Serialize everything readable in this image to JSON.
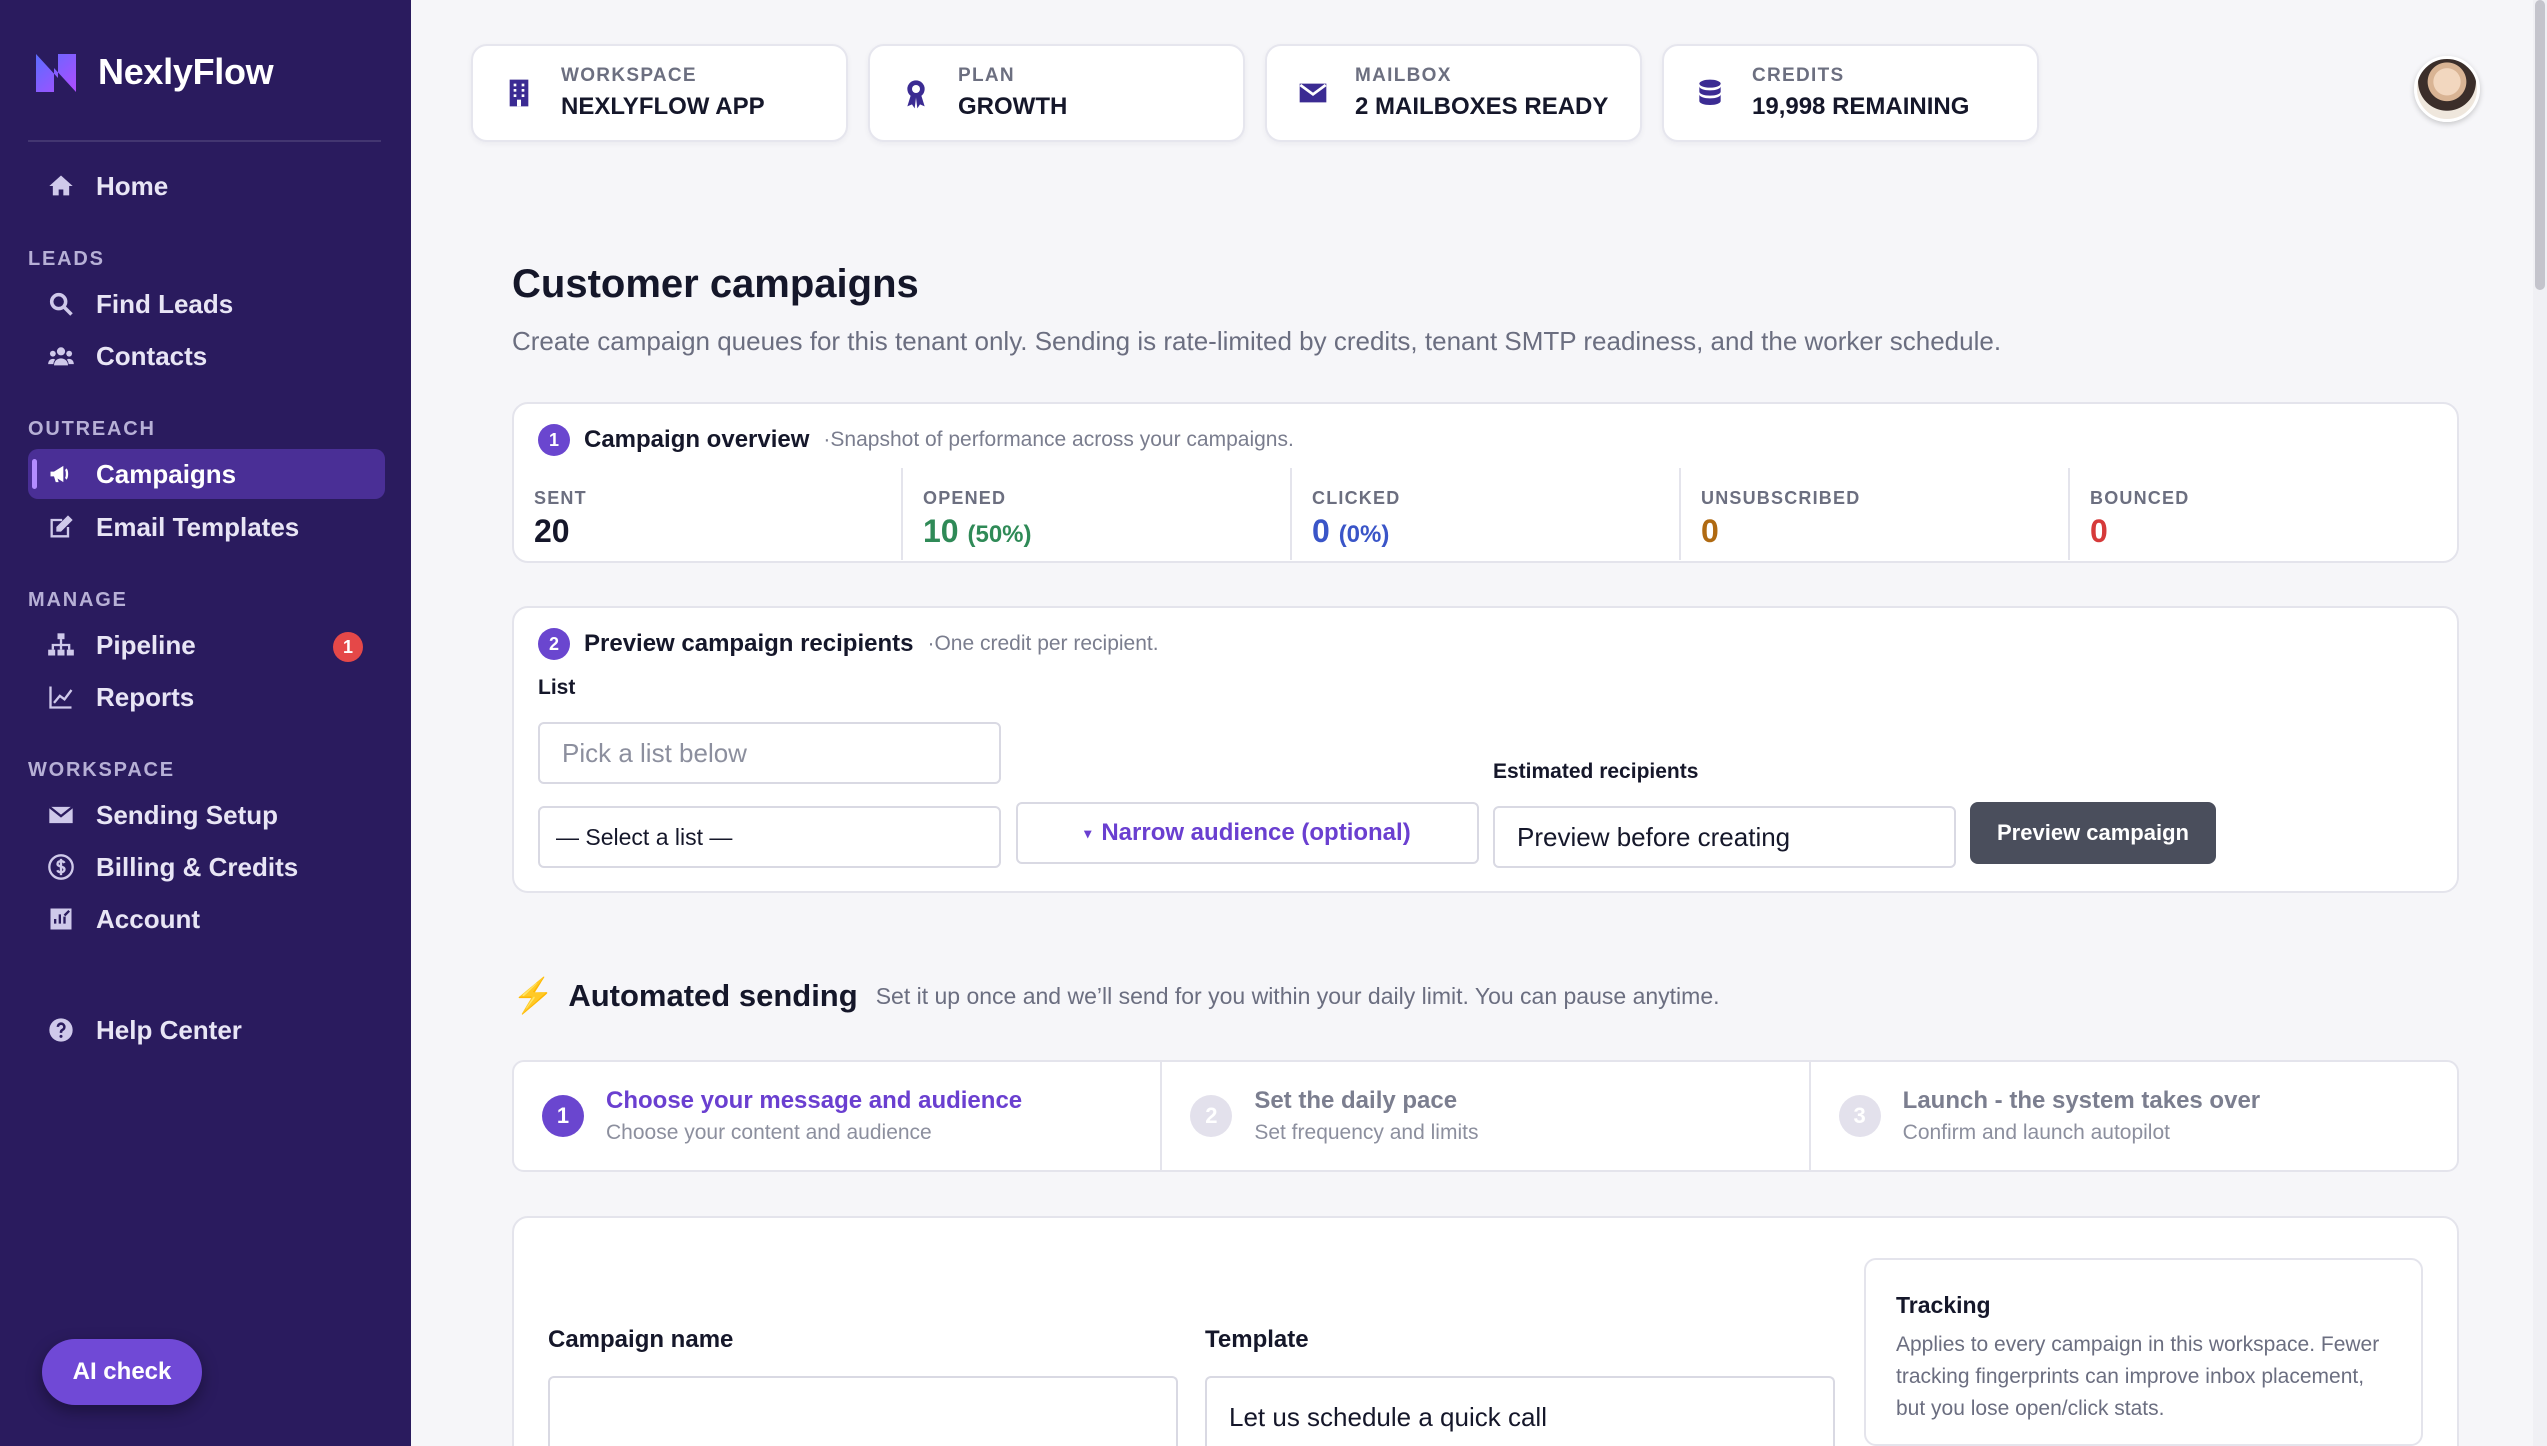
{
  "app": {
    "name": "NexlyFlow"
  },
  "sidebar": {
    "home": "Home",
    "sections": {
      "leads": "LEADS",
      "outreach": "OUTREACH",
      "manage": "MANAGE",
      "workspace": "WORKSPACE"
    },
    "leads": [
      "Find Leads",
      "Contacts"
    ],
    "outreach": [
      "Campaigns",
      "Email Templates"
    ],
    "manage": [
      "Pipeline",
      "Reports"
    ],
    "pipeline_badge": "1",
    "workspace": [
      "Sending Setup",
      "Billing & Credits",
      "Account"
    ],
    "help": "Help Center",
    "ai_check": "AI check"
  },
  "header": {
    "cards": [
      {
        "label": "WORKSPACE",
        "value": "NEXLYFLOW APP",
        "icon": "building-icon"
      },
      {
        "label": "PLAN",
        "value": "GROWTH",
        "icon": "award-icon"
      },
      {
        "label": "MAILBOX",
        "value": "2 MAILBOXES READY",
        "icon": "envelope-icon"
      },
      {
        "label": "CREDITS",
        "value": "19,998 REMAINING",
        "icon": "database-icon"
      }
    ]
  },
  "page": {
    "title": "Customer campaigns",
    "subtitle": "Create campaign queues for this tenant only. Sending is rate-limited by credits, tenant SMTP readiness, and the worker schedule."
  },
  "overview": {
    "step": "1",
    "title": "Campaign overview",
    "hint": "·Snapshot of performance across your campaigns.",
    "stats": [
      {
        "label": "SENT",
        "value": "20",
        "pct": "",
        "color": "#15172a"
      },
      {
        "label": "OPENED",
        "value": "10",
        "pct": "(50%)",
        "color": "#2f8a57"
      },
      {
        "label": "CLICKED",
        "value": "0",
        "pct": "(0%)",
        "color": "#3a55c8"
      },
      {
        "label": "UNSUBSCRIBED",
        "value": "0",
        "pct": "",
        "color": "#b06a12"
      },
      {
        "label": "BOUNCED",
        "value": "0",
        "pct": "",
        "color": "#d63a3a"
      }
    ]
  },
  "preview": {
    "step": "2",
    "title": "Preview campaign recipients",
    "hint": "·One credit per recipient.",
    "list_label": "List",
    "list_placeholder": "Pick a list below",
    "select_value": "— Select a list —",
    "narrow_label": "Narrow audience (optional)",
    "estimated_label": "Estimated recipients",
    "estimated_value": "Preview before creating",
    "button": "Preview campaign"
  },
  "automated": {
    "title": "Automated sending",
    "subtitle": "Set it up once and we’ll send for you within your daily limit. You can pause anytime.",
    "steps": [
      {
        "num": "1",
        "title": "Choose your message and audience",
        "sub": "Choose your content and audience"
      },
      {
        "num": "2",
        "title": "Set the daily pace",
        "sub": "Set frequency and limits"
      },
      {
        "num": "3",
        "title": "Launch - the system takes over",
        "sub": "Confirm and launch autopilot"
      }
    ]
  },
  "form": {
    "campaign_name_label": "Campaign name",
    "campaign_name_value": "",
    "template_label": "Template",
    "template_value": "Let us schedule a quick call"
  },
  "tracking": {
    "title": "Tracking",
    "text": "Applies to every campaign in this workspace. Fewer tracking fingerprints can improve inbox placement, but you lose open/click stats."
  }
}
